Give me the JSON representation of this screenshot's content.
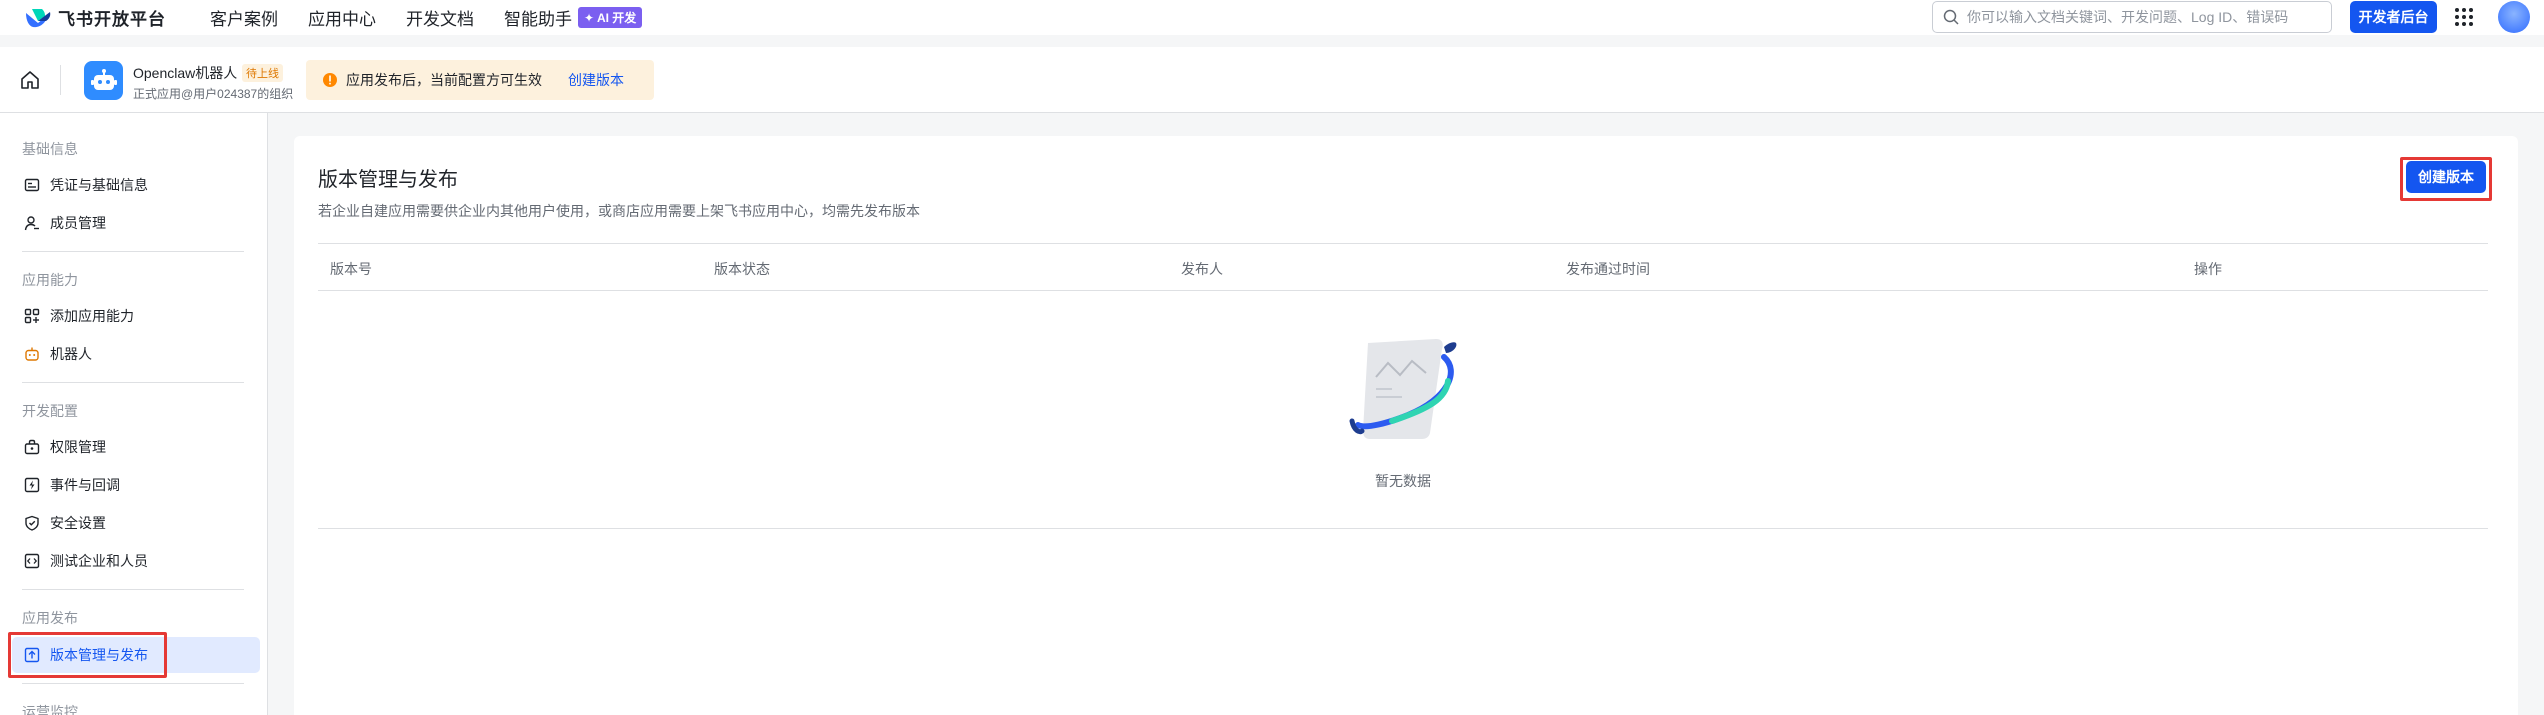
{
  "topbar": {
    "brand": "飞书开放平台",
    "nav": [
      "客户案例",
      "应用中心",
      "开发文档"
    ],
    "ai_item": "智能助手",
    "ai_badge": "✦ AI 开发",
    "search_placeholder": "你可以输入文档关键词、开发问题、Log ID、错误码",
    "dev_console": "开发者后台",
    "icons": [
      "search-icon",
      "apps-grid-icon"
    ]
  },
  "app": {
    "name": "Openclaw机器人",
    "status": "待上线",
    "subtitle": "正式应用@用户024387的组织",
    "notice": "应用发布后，当前配置方可生效",
    "notice_link": "创建版本"
  },
  "sidebar": {
    "groups": [
      {
        "title": "基础信息",
        "items": [
          "凭证与基础信息",
          "成员管理"
        ]
      },
      {
        "title": "应用能力",
        "items": [
          "添加应用能力",
          "机器人"
        ]
      },
      {
        "title": "开发配置",
        "items": [
          "权限管理",
          "事件与回调",
          "安全设置",
          "测试企业和人员"
        ]
      },
      {
        "title": "应用发布",
        "items": [
          "版本管理与发布"
        ]
      },
      {
        "title": "运营监控",
        "items": []
      }
    ],
    "active_item": "版本管理与发布"
  },
  "main": {
    "title": "版本管理与发布",
    "description": "若企业自建应用需要供企业内其他用户使用，或商店应用需要上架飞书应用中心，均需先发布版本",
    "create_button": "创建版本",
    "columns": [
      "版本号",
      "版本状态",
      "发布人",
      "发布通过时间",
      "操作"
    ],
    "rows": [],
    "empty_text": "暂无数据"
  },
  "colors": {
    "primary": "#1456f0",
    "highlight": "#e53935",
    "status_orange": "#de7802",
    "notice_bg": "#fdf1dd",
    "active_bg": "#e1eaff"
  }
}
